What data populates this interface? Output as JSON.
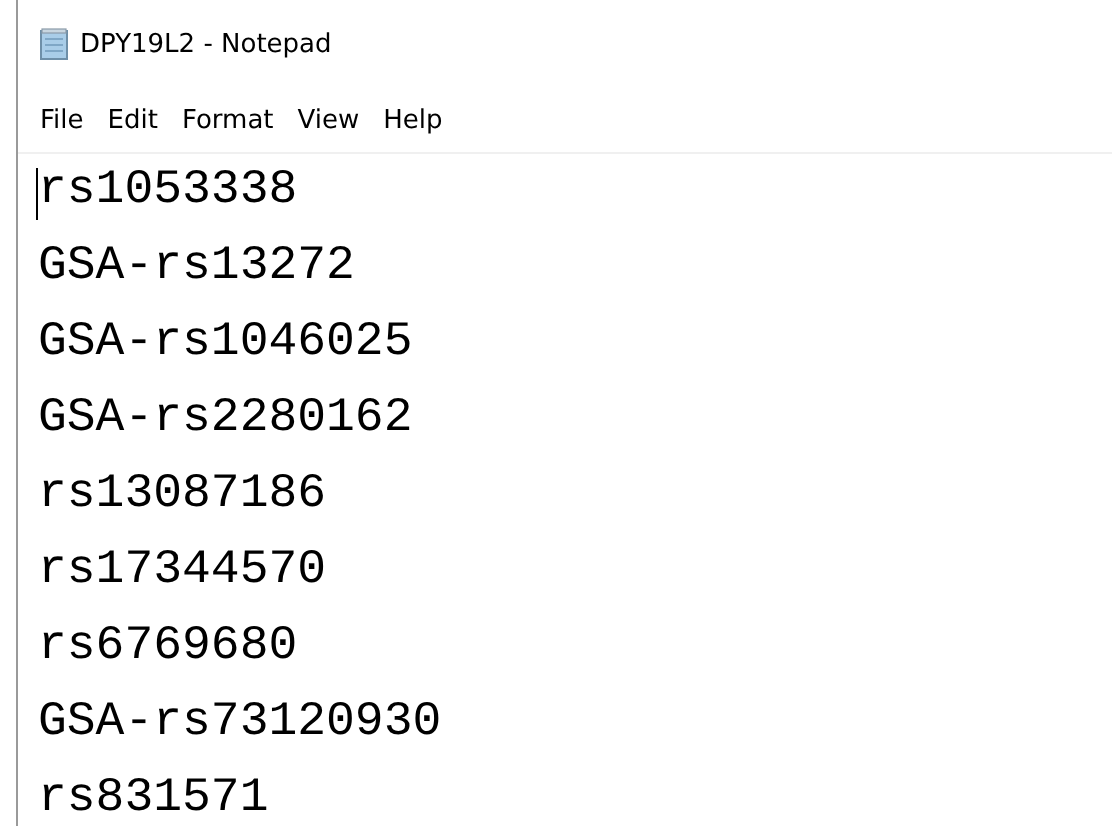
{
  "window": {
    "title": "DPY19L2 - Notepad"
  },
  "menu": [
    "File",
    "Edit",
    "Format",
    "View",
    "Help"
  ],
  "lines": [
    "rs1053338",
    "GSA-rs13272",
    "GSA-rs1046025",
    "GSA-rs2280162",
    "rs13087186",
    "rs17344570",
    "rs6769680",
    "GSA-rs73120930",
    "rs831571"
  ]
}
